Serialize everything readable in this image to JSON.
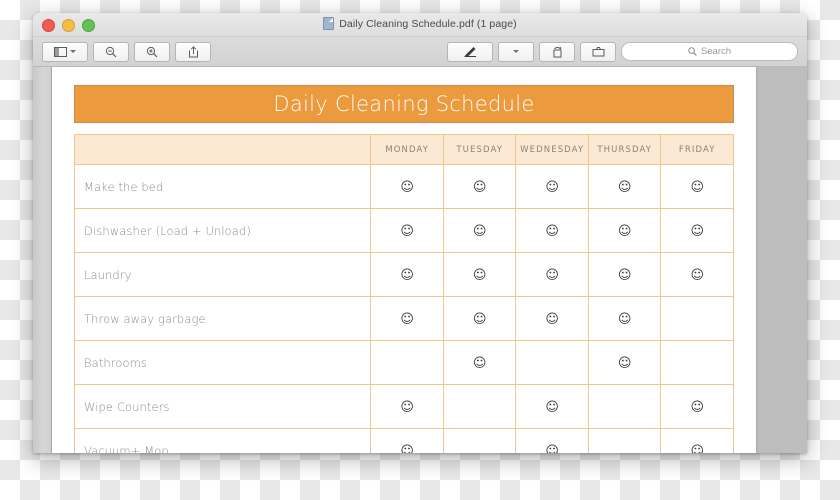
{
  "window": {
    "titlebar": {
      "title": "Daily Cleaning Schedule.pdf (1 page)",
      "doc_icon": "pdf-document-icon",
      "close_label": "Close",
      "minimize_label": "Minimize",
      "maximize_label": "Maximize"
    },
    "toolbar": {
      "sidebar_button": "sidebar-view-icon",
      "sidebar_caret": "chevron-down-icon",
      "zoom_out": "zoom-out-icon",
      "zoom_in": "zoom-in-icon",
      "share": "share-icon",
      "markup": "markup-pen-icon",
      "markup_caret": "chevron-down-icon",
      "rotate": "rotate-icon",
      "crop": "crop-icon",
      "search_placeholder": "Search",
      "search_value": "",
      "search_icon": "search-icon"
    }
  },
  "document": {
    "banner_title": "Daily Cleaning Schedule",
    "columns": [
      "",
      "Monday",
      "Tuesday",
      "Wednesday",
      "Thursday",
      "Friday"
    ],
    "check_glyph": "☺",
    "rows": [
      {
        "task": "Make the bed",
        "days": [
          true,
          true,
          true,
          true,
          true
        ]
      },
      {
        "task": "Dishwasher (Load + Unload)",
        "days": [
          true,
          true,
          true,
          true,
          true
        ]
      },
      {
        "task": "Laundry",
        "days": [
          true,
          true,
          true,
          true,
          true
        ]
      },
      {
        "task": "Throw away garbage",
        "days": [
          true,
          true,
          true,
          true,
          false
        ]
      },
      {
        "task": "Bathrooms",
        "days": [
          false,
          true,
          false,
          true,
          false
        ]
      },
      {
        "task": "Wipe Counters",
        "days": [
          true,
          false,
          true,
          false,
          true
        ]
      },
      {
        "task": "Vacuum+ Mop",
        "days": [
          true,
          false,
          true,
          false,
          true
        ]
      }
    ]
  },
  "colors": {
    "banner_bg": "#eb9a3e",
    "banner_border": "#c98a55",
    "table_border": "#f2c48e",
    "header_bg": "#fbe9d4",
    "text_gray": "#8c8c8c"
  }
}
